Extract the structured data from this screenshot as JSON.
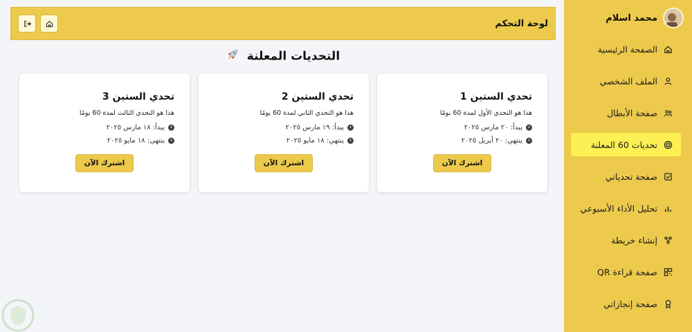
{
  "sidebar": {
    "user_name": "محمد اسلام",
    "items": [
      {
        "label": "الصفحة الرئيسية",
        "icon": "home-icon",
        "active": false
      },
      {
        "label": "الملف الشخصي",
        "icon": "user-icon",
        "active": false
      },
      {
        "label": "صفحة الأبطال",
        "icon": "users-icon",
        "active": false
      },
      {
        "label": "تحديات 60 المعلنة",
        "icon": "target-icon",
        "active": true
      },
      {
        "label": "صفحة تحدياتي",
        "icon": "checkbox-icon",
        "active": false
      },
      {
        "label": "تحليل الأداء الأسبوعي",
        "icon": "bar-chart-icon",
        "active": false
      },
      {
        "label": "إنشاء خريطة",
        "icon": "mindmap-icon",
        "active": false
      },
      {
        "label": "صفحة قراءة QR",
        "icon": "qr-code-icon",
        "active": false
      },
      {
        "label": "صفحة إنجازاتي",
        "icon": "award-icon",
        "active": false
      }
    ],
    "accent": "#edca4c",
    "active_color": "#fdf054"
  },
  "header": {
    "title": "لوحة التحكم",
    "buttons": [
      "home-icon",
      "logout-icon"
    ]
  },
  "main": {
    "heading": "التحديات المعلنة",
    "heading_icon": "rocket-icon",
    "cards": [
      {
        "title": "تحدي الستين 1",
        "description": "هذا هو التحدي الأول لمدة 60 يومًا",
        "start": "يبدأ: ٢٠ مارس ٢٠٢٥",
        "end": "ينتهي: ٢٠ أبريل ٢٠٢٥",
        "button": "اشترك الآن"
      },
      {
        "title": "تحدي الستين 2",
        "description": "هذا هو التحدي الثاني لمدة 60 يومًا",
        "start": "يبدأ: ١٩ مارس ٢٠٢٥",
        "end": "ينتهي: ١٨ مايو ٢٠٢٥",
        "button": "اشترك الآن"
      },
      {
        "title": "تحدي الستين 3",
        "description": "هذا هو التحدي الثالث لمدة 60 يومًا",
        "start": "يبدأ: ١٨ مارس ٢٠٢٥",
        "end": "ينتهي: ١٨ مايو ٢٠٢٥",
        "button": "اشترك الآن"
      }
    ]
  }
}
